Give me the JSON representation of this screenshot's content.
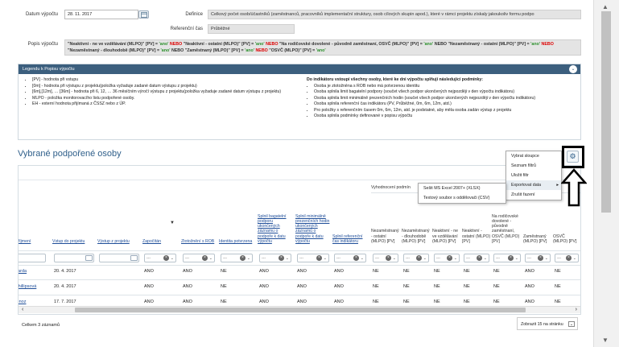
{
  "form": {
    "datum_label": "Datum výpočtu",
    "datum_value": "28. 11. 2017",
    "definice_label": "Definice",
    "definice_value": "Celkový počet osob/účastníků (zaměstnanců, pracovníků implementační struktury, osob cílových skupin apod.), které v rámci projektu získaly jakoukoliv formu podpo",
    "ref_cas_label": "Referenční čas",
    "ref_cas_value": "Průběžné",
    "popis_label": "Popis výpočtu",
    "popis_parts": [
      {
        "t": "\"Neaktivní - ne ve vzdělávání (MLPO)\" [PV] = ",
        "c": ""
      },
      {
        "t": "'ano'",
        "c": "g"
      },
      {
        "t": " NEBO ",
        "c": "r"
      },
      {
        "t": "\"Neaktivní - ostatní (MLPO)\" [PV] = ",
        "c": ""
      },
      {
        "t": "'ano'",
        "c": "g"
      },
      {
        "t": " NEBO ",
        "c": "r"
      },
      {
        "t": "\"Na rodičovské dovolené - původně zaměstnaní, OSVČ (MLPO)\" [PV] = ",
        "c": ""
      },
      {
        "t": "'ano'",
        "c": "g"
      },
      {
        "t": " NEBO \"Nezaměstnaný - ostatní (MLPO)\" [PV] = ",
        "c": ""
      },
      {
        "t": "'ano'",
        "c": "g"
      },
      {
        "t": " NEBO ",
        "c": "r"
      },
      {
        "t": "\"Nezaměstnaný - dlouhodobě (MLPO)\" [PV] = ",
        "c": ""
      },
      {
        "t": "'ano'",
        "c": "g"
      },
      {
        "t": " NEBO \"Zaměstnaný (MLPO)\" [PV] = ",
        "c": ""
      },
      {
        "t": "'ano'",
        "c": "g"
      },
      {
        "t": " NEBO ",
        "c": "r"
      },
      {
        "t": "\"OSVČ (MLPO)\" [PV] = ",
        "c": ""
      },
      {
        "t": "'ano'",
        "c": "g"
      }
    ]
  },
  "legend": {
    "title": "Legendu k Popisu výpočtu",
    "left_items": [
      "[PV] - hodnota při vstupu",
      "[0m] - hodnota při výstupu z projektu(položka vyžaduje zadané datum výstupu z projektu)",
      "[6m],[12m], … [36m] - hodnota při 6, 12, … 36 měsíčním výročí výstupu z projektu(položka vyžaduje zadané datum výstupu z projektu)",
      "MLPO - položka monitorovacího listu podpořené osoby.",
      "EH - externí hodnota přijímaná z ČSSZ nebo z ÚP."
    ],
    "right_heading": "Do indikátoru vstoupí všechny osoby, které ke dni výpočtu splňují následující podmínky:",
    "right_items": [
      "Osoba je ztotožněna s ROB nebo má potvrzenou identitu",
      "Osoba splnila limit bagatelní podpory (součet všech podpor ukončených nejpozději v den výpočtu indikátoru)",
      "Osoba splnila limit minimálně prezenčních hodin (součet všech podpor ukončených nejpozději v den výpočtu indikátoru)",
      "Osoba splnila referenční čas indikátoru (PV, Průběžné, 0m, 6m, 12m, atd.)",
      "Pro položky s referenčním časem 0m, 6m, 12m, atd. je podstatné, aby měla osoba zadán výstup z projektu",
      "Osoba splnila podmínky definované v popisu výpočtu"
    ]
  },
  "section_title": "Vybrané podpořené osoby",
  "grid": {
    "group_header": "Vyhodnocení podmín",
    "columns": [
      {
        "label": "Příjmení",
        "link": true
      },
      {
        "label": "Vstup do projektu",
        "link": true
      },
      {
        "label": "Výstup z projektu",
        "link": true
      },
      {
        "label": "Započítán",
        "link": true
      },
      {
        "label": "Ztotožnění s ROB",
        "link": true
      },
      {
        "label": "Identita potvrzena",
        "link": true
      },
      {
        "label": "Splnil bagatelní podporu ukončených záznamu o podpoře k datu výpočtu",
        "link": true
      },
      {
        "label": "Splnil minimálně prezenčních hodin ukončených záznamů o podpoře k datu výpočtu",
        "link": true
      },
      {
        "label": "Splnil referenční čas indikátoru",
        "link": true
      },
      {
        "label": "Nezaměstnaný - ostatní (MLPO) [PV]",
        "link": false
      },
      {
        "label": "Nezaměstnaný - dlouhodobě (MLPO) [PV]",
        "link": false
      },
      {
        "label": "Neaktivní - ne ve vzdělávání (MLPO) [PV]",
        "link": false
      },
      {
        "label": "Neaktivní - ostatní (MLPO) [PV]",
        "link": false
      },
      {
        "label": "Na rodičovské dovolené - původně zaměstnaní, OSVČ (MLPO) [PV]",
        "link": false
      },
      {
        "label": "Zaměstnaný (MLPO) [PV]",
        "link": false
      },
      {
        "label": "OSVČ (MLPO) [PV]",
        "link": false
      }
    ],
    "filter_placeholder": "---",
    "rows": [
      [
        "narda",
        "20. 4. 2017",
        "",
        "ANO",
        "ANO",
        "NE",
        "ANO",
        "ANO",
        "ANO",
        "NE",
        "NE",
        "NE",
        "NE",
        "NE",
        "ANO",
        "NE"
      ],
      [
        "Phillipsová",
        "20. 4. 2017",
        "",
        "ANO",
        "ANO",
        "NE",
        "ANO",
        "ANO",
        "ANO",
        "NE",
        "NE",
        "NE",
        "NE",
        "NE",
        "ANO",
        "NE"
      ],
      [
        "tenoz",
        "17. 7. 2017",
        "",
        "ANO",
        "ANO",
        "NE",
        "ANO",
        "ANO",
        "ANO",
        "NE",
        "NE",
        "NE",
        "NE",
        "NE",
        "ANO",
        "NE"
      ]
    ],
    "sort_indicator": "▼"
  },
  "settings_menu": [
    "Vybrat sloupce",
    "Seznam filtrů",
    "Uložit filtr",
    "Exportovat data",
    "Zrušit řazení"
  ],
  "export_submenu": [
    "Sešit MS Excel 2007+ (XLSX)",
    "Textový soubor s oddělovači (CSV)"
  ],
  "footer": {
    "count": "Celkem 3 záznamů",
    "pager": "Zobrazit 15 na stránku"
  },
  "colors": {
    "accent": "#2f5f8a",
    "legend_bar": "#3c5f7e",
    "link": "#1f4e99",
    "highlight": "#000000"
  }
}
